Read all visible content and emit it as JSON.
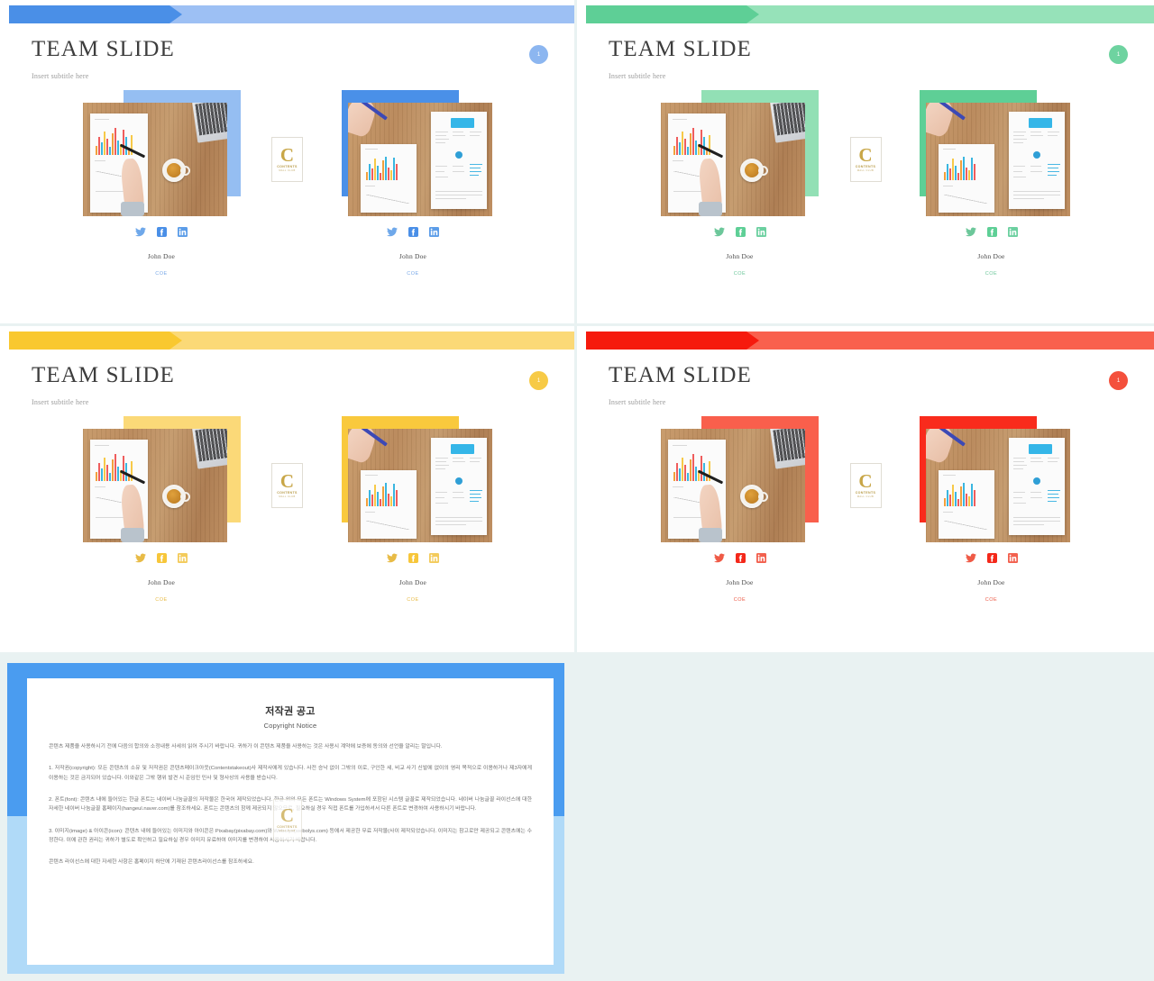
{
  "page": {
    "background_color": "#e9f2f2",
    "gutter_color": "#e9f2f2"
  },
  "slides": [
    {
      "id": "slide-blue",
      "accent": "#4a90e8",
      "accent_light": "#95bef2",
      "banner_head": "#4a8fe7",
      "banner_tail": "#9dc0f4",
      "badge_color": "#8cb6f0",
      "badge_label": "1",
      "title": "TEAM SLIDE",
      "subtitle": "Insert subtitle here",
      "members": [
        {
          "name": "John Doe",
          "role": "COE",
          "role_color": "#7aa9e8"
        },
        {
          "name": "John Doe",
          "role": "COE",
          "role_color": "#7aa9e8"
        }
      ],
      "social": [
        "twitter-icon",
        "facebook-icon",
        "linkedin-icon"
      ]
    },
    {
      "id": "slide-green",
      "accent": "#5ecf96",
      "accent_light": "#92e0b5",
      "banner_head": "#5ecf96",
      "banner_tail": "#96e2b9",
      "badge_color": "#6ed3a0",
      "badge_label": "1",
      "title": "TEAM SLIDE",
      "subtitle": "Insert subtitle here",
      "members": [
        {
          "name": "John Doe",
          "role": "COE",
          "role_color": "#6cc79a"
        },
        {
          "name": "John Doe",
          "role": "COE",
          "role_color": "#6cc79a"
        }
      ],
      "social": [
        "twitter-icon",
        "facebook-icon",
        "linkedin-icon"
      ]
    },
    {
      "id": "slide-yellow",
      "accent": "#f9c93d",
      "accent_light": "#fbd978",
      "banner_head": "#f9c82f",
      "banner_tail": "#fbd977",
      "badge_color": "#f7ca46",
      "badge_label": "1",
      "title": "TEAM SLIDE",
      "subtitle": "Insert subtitle here",
      "members": [
        {
          "name": "John Doe",
          "role": "COE",
          "role_color": "#e8bb46"
        },
        {
          "name": "John Doe",
          "role": "COE",
          "role_color": "#e8bb46"
        }
      ],
      "social": [
        "twitter-icon",
        "facebook-icon",
        "linkedin-icon"
      ]
    },
    {
      "id": "slide-red",
      "accent": "#f92b1c",
      "accent_light": "#f95f4c",
      "banner_head": "#f61a0d",
      "banner_tail": "#f9604d",
      "badge_color": "#f4503c",
      "badge_label": "1",
      "title": "TEAM SLIDE",
      "subtitle": "Insert subtitle here",
      "members": [
        {
          "name": "John Doe",
          "role": "COE",
          "role_color": "#ed5a46"
        },
        {
          "name": "John Doe",
          "role": "COE",
          "role_color": "#ed5a46"
        }
      ],
      "social": [
        "twitter-icon",
        "facebook-icon",
        "linkedin-icon"
      ]
    }
  ],
  "logo": {
    "letter": "C",
    "word": "CONTENTS",
    "tagline": "MALL  CLUB"
  },
  "copyright": {
    "frame_top_color": "#4a9cf0",
    "frame_bottom_color": "#b0daf8",
    "heading_ko": "저작권 공고",
    "heading_en": "Copyright Notice",
    "intro": "콘텐츠 제품을 사용하시기 전에 다음의 합의와 소정내용 사세히 읽어 주시기 바랍니다. 귀하가 이 콘텐츠 제품을 사용하는 것은 사용시 계약에 보증에 동의와 선언을 알리는 말입니다.",
    "p1": "1. 저작권(copyright): 모든 콘텐츠의 소유 및 저작권은 콘텐츠메이크아웃(Contentstakeout)사 제작사에게 있습니다. 사전 승낙 없이 그밖의 이로, 구인한 세, 비교 사기 신발에 없이의 영리 목적으로 이용하거나 제3자에게 이용하는 것은 금지되어 있습니다. 이와같은 그밖 행위 발견 시 준임민 민사 및 형사상의 사용을 받습니다.",
    "p2": "2. 폰트(font): 콘텐츠 내에 들어있는 한글 폰트는 네이버 나눔글꼴의 저작물은 한국어 제작되었습니다. 한글 외의 모든 폰트는 Windows System에 포함된 시스템 글꼴로 제작되었습니다. 네이버 나눔글꼴 라이선스에 대한 자세한 네이버 나눔글꼴 홈페이지(hangeul.naver.com)를 참조하세요. 폰트는 콘텐츠의 함께 제공되지 않으므로, 필요하실 경우 직접 폰트를 가입하셔서 다른 폰트로 변경하여 사용하시기 바랍니다.",
    "p3": "3. 이미지(image) & 아이콘(icon): 콘텐츠 내에 들어있는 이미지와 아이콘은 Pixabay(pixabay.com)와 Webolys(webolys.com) 등에서 제공한 무료 저작물(사이 제작되었습니다. 이미지는 참고로만 제공되고 콘텐츠에는 수정한다. 이에 관한 권리는 귀하가 별도로 확인하고 필요하실 경우 이미지 유료하여 이미지를 변경하여 사용하시기 바랍니다.",
    "p4": "콘텐츠 라이선스에 대한 자세한 사항은 홈페이지 하단에 기재된 콘텐츠라이선스를 참조하세요."
  }
}
